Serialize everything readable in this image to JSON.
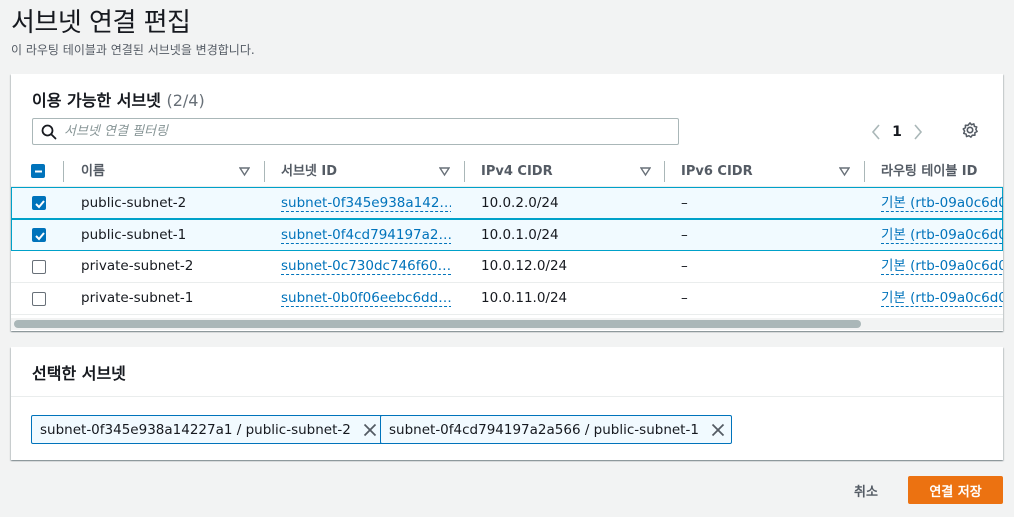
{
  "header": {
    "title": "서브넷 연결 편집",
    "description": "이 라우팅 테이블과 연결된 서브넷을 변경합니다."
  },
  "available": {
    "title": "이용 가능한 서브넷",
    "count": "(2/4)",
    "filter_placeholder": "서브넷 연결 필터링",
    "page_number": "1",
    "columns": [
      "이름",
      "서브넷 ID",
      "IPv4 CIDR",
      "IPv6 CIDR",
      "라우팅 테이블 ID"
    ],
    "rows": [
      {
        "checked": true,
        "name": "public-subnet-2",
        "subnet_id": "subnet-0f345e938a142…",
        "ipv4": "10.0.2.0/24",
        "ipv6": "–",
        "route_table": "기본 (rtb-09a0c6d0("
      },
      {
        "checked": true,
        "name": "public-subnet-1",
        "subnet_id": "subnet-0f4cd794197a2…",
        "ipv4": "10.0.1.0/24",
        "ipv6": "–",
        "route_table": "기본 (rtb-09a0c6d0("
      },
      {
        "checked": false,
        "name": "private-subnet-2",
        "subnet_id": "subnet-0c730dc746f60…",
        "ipv4": "10.0.12.0/24",
        "ipv6": "–",
        "route_table": "기본 (rtb-09a0c6d0("
      },
      {
        "checked": false,
        "name": "private-subnet-1",
        "subnet_id": "subnet-0b0f06eebc6dd…",
        "ipv4": "10.0.11.0/24",
        "ipv6": "–",
        "route_table": "기본 (rtb-09a0c6d0("
      }
    ]
  },
  "selected": {
    "title": "선택한 서브넷",
    "tokens": [
      "subnet-0f345e938a14227a1 / public-subnet-2",
      "subnet-0f4cd794197a2a566 / public-subnet-1"
    ]
  },
  "footer": {
    "cancel_label": "취소",
    "save_label": "연결 저장"
  },
  "colors": {
    "accent": "#0073bb",
    "primary_button": "#ec7211",
    "selected_row_bg": "#f1faff"
  }
}
